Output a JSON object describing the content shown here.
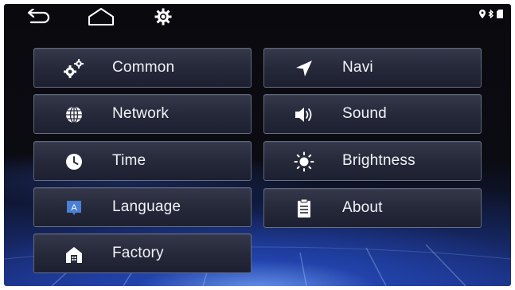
{
  "top_bar": {
    "icons": [
      "back-icon",
      "home-icon",
      "settings-gear-icon"
    ],
    "status_icons": [
      "location-pin-icon",
      "bluetooth-icon",
      "sd-card-icon"
    ]
  },
  "menu": {
    "left": [
      {
        "label": "Common",
        "icon": "gears-icon"
      },
      {
        "label": "Network",
        "icon": "globe-icon"
      },
      {
        "label": "Time",
        "icon": "clock-icon"
      },
      {
        "label": "Language",
        "icon": "language-icon"
      },
      {
        "label": "Factory",
        "icon": "factory-home-icon"
      }
    ],
    "right": [
      {
        "label": "Navi",
        "icon": "navigation-arrow-icon"
      },
      {
        "label": "Sound",
        "icon": "speaker-icon"
      },
      {
        "label": "Brightness",
        "icon": "brightness-icon"
      },
      {
        "label": "About",
        "icon": "clipboard-icon"
      }
    ]
  },
  "colors": {
    "accent_background": "#0b0b12",
    "glow": "#2a4bd0",
    "tile": "#2a2d3e",
    "text": "#f1f3f7"
  }
}
